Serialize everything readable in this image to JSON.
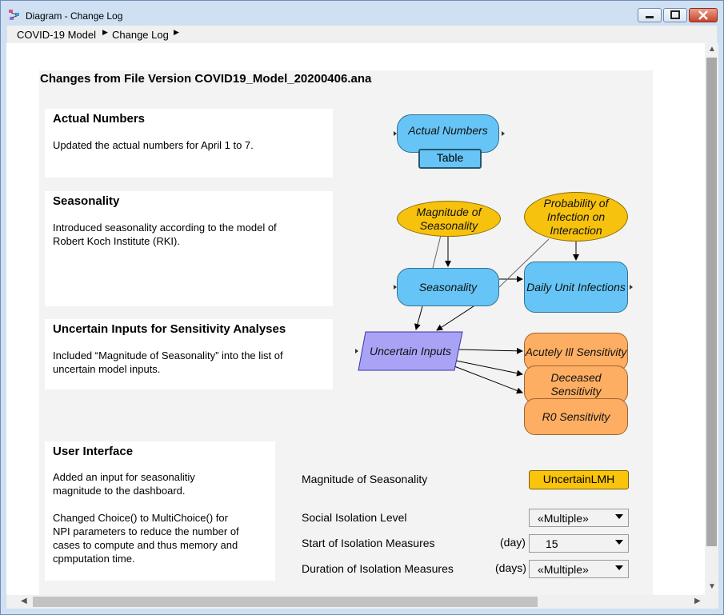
{
  "window": {
    "title": "Diagram - Change Log"
  },
  "breadcrumb": [
    "COVID-19 Model",
    "Change Log"
  ],
  "panel": {
    "title": "Changes from File Version COVID19_Model_20200406.ana"
  },
  "notes": [
    {
      "heading": "Actual Numbers",
      "lines": [
        "Updated the actual numbers for April 1 to 7."
      ]
    },
    {
      "heading": "Seasonality",
      "lines": [
        "Introduced seasonality according to the model of",
        "Robert Koch Institute (RKI)."
      ]
    },
    {
      "heading": "Uncertain Inputs for Sensitivity Analyses",
      "lines": [
        "Included “Magnitude of Seasonality” into the list of",
        "uncertain model inputs."
      ]
    },
    {
      "heading": "User Interface",
      "lines": [
        "Added an input for seasonalitiy",
        "magnitude to the dashboard.",
        "",
        "Changed Choice() to MultiChoice() for",
        "NPI parameters to reduce the number of",
        "cases to compute and thus memory and",
        "cpmputation time."
      ]
    }
  ],
  "nodes": {
    "actual_numbers": {
      "label": "Actual Numbers",
      "button": "Table"
    },
    "magnitude_seasonality": "Magnitude of Seasonality",
    "probability_infection": "Probability of Infection on Interaction",
    "seasonality": "Seasonality",
    "daily_unit_infections": "Daily Unit Infections",
    "uncertain_inputs": "Uncertain Inputs",
    "acutely_ill": "Acutely Ill Sensitivity",
    "deceased": "Deceased Sensitivity",
    "r0": "R0 Sensitivity"
  },
  "controls": {
    "magnitude": {
      "label": "Magnitude of Seasonality",
      "value": "UncertainLMH"
    },
    "social": {
      "label": "Social Isolation Level",
      "value": "«Multiple»"
    },
    "start": {
      "label": "Start of Isolation Measures",
      "unit": "(day)",
      "value": "15"
    },
    "duration": {
      "label": "Duration of Isolation Measures",
      "unit": "(days)",
      "value": "«Multiple»"
    }
  },
  "colors": {
    "variable": "#66c5f6",
    "chance": "#f6c20e",
    "objective": "#fdae63",
    "list": "#a9a3f6"
  }
}
